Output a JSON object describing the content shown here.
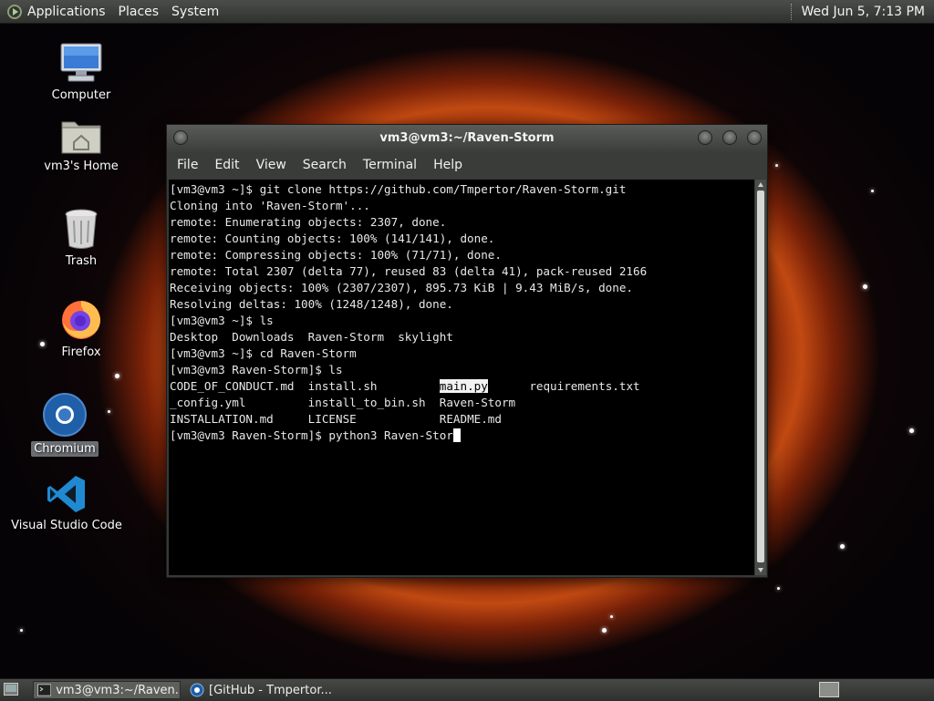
{
  "top_panel": {
    "menus": [
      "Applications",
      "Places",
      "System"
    ],
    "clock": "Wed Jun  5,  7:13 PM"
  },
  "desktop_icons": [
    {
      "label": "Computer",
      "icon": "computer-icon"
    },
    {
      "label": "vm3's Home",
      "icon": "home-folder-icon"
    },
    {
      "label": "Trash",
      "icon": "trash-icon"
    },
    {
      "label": "Firefox",
      "icon": "firefox-icon"
    },
    {
      "label": "Chromium",
      "icon": "chromium-icon",
      "selected": true
    },
    {
      "label": "Visual Studio Code",
      "icon": "vscode-icon"
    }
  ],
  "terminal": {
    "title": "vm3@vm3:~/Raven-Storm",
    "menus": [
      "File",
      "Edit",
      "View",
      "Search",
      "Terminal",
      "Help"
    ],
    "lines": [
      "[vm3@vm3 ~]$ git clone https://github.com/Tmpertor/Raven-Storm.git",
      "Cloning into 'Raven-Storm'...",
      "remote: Enumerating objects: 2307, done.",
      "remote: Counting objects: 100% (141/141), done.",
      "remote: Compressing objects: 100% (71/71), done.",
      "remote: Total 2307 (delta 77), reused 83 (delta 41), pack-reused 2166",
      "Receiving objects: 100% (2307/2307), 895.73 KiB | 9.43 MiB/s, done.",
      "Resolving deltas: 100% (1248/1248), done.",
      "[vm3@vm3 ~]$ ls",
      "Desktop  Downloads  Raven-Storm  skylight",
      "[vm3@vm3 ~]$ cd Raven-Storm",
      "[vm3@vm3 Raven-Storm]$ ls"
    ],
    "ls_columns": [
      [
        "CODE_OF_CONDUCT.md",
        "install.sh",
        "main.py",
        "requirements.txt"
      ],
      [
        "_config.yml",
        "install_to_bin.sh",
        "Raven-Storm",
        ""
      ],
      [
        "INSTALLATION.md",
        "LICENSE",
        "README.md",
        ""
      ]
    ],
    "highlighted_entry": "main.py",
    "current_prompt": "[vm3@vm3 Raven-Storm]$ python3 Raven-Stor"
  },
  "taskbar": {
    "items": [
      {
        "label": "vm3@vm3:~/Raven...",
        "icon": "terminal-icon",
        "active": true
      },
      {
        "label": "[GitHub - Tmpertor...",
        "icon": "chromium-icon",
        "active": false
      }
    ]
  },
  "colors": {
    "panel": "#3c3e3b",
    "terminal_bg": "#000000",
    "terminal_fg": "#e8e8e8"
  }
}
